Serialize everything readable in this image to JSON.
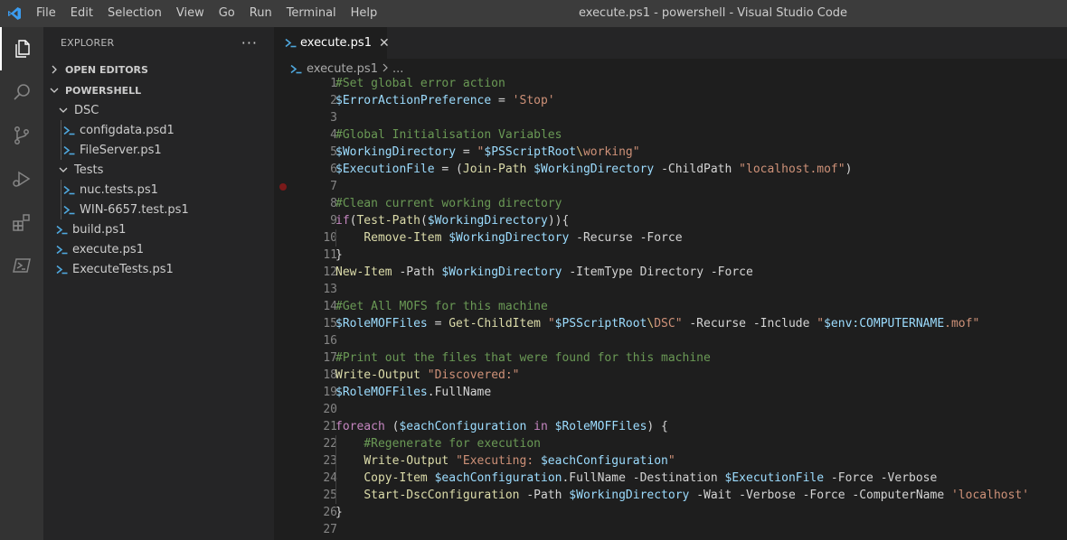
{
  "titlebar": {
    "menu": [
      "File",
      "Edit",
      "Selection",
      "View",
      "Go",
      "Run",
      "Terminal",
      "Help"
    ],
    "window_title": "execute.ps1 - powershell - Visual Studio Code"
  },
  "activitybar": {
    "items": [
      "explorer-icon",
      "search-icon",
      "source-control-icon",
      "run-debug-icon",
      "extensions-icon",
      "powershell-icon"
    ]
  },
  "sidebar": {
    "header": "EXPLORER",
    "more": "···",
    "open_editors": "OPEN EDITORS",
    "workspace": "POWERSHELL",
    "tree": [
      {
        "label": "DSC",
        "type": "folder",
        "depth": 1
      },
      {
        "label": "configdata.psd1",
        "type": "file",
        "depth": 2
      },
      {
        "label": "FileServer.ps1",
        "type": "file",
        "depth": 2
      },
      {
        "label": "Tests",
        "type": "folder",
        "depth": 1
      },
      {
        "label": "nuc.tests.ps1",
        "type": "file",
        "depth": 2
      },
      {
        "label": "WIN-6657.test.ps1",
        "type": "file",
        "depth": 2
      },
      {
        "label": "build.ps1",
        "type": "file",
        "depth": 1
      },
      {
        "label": "execute.ps1",
        "type": "file",
        "depth": 1
      },
      {
        "label": "ExecuteTests.ps1",
        "type": "file",
        "depth": 1
      }
    ]
  },
  "editor": {
    "tab_label": "execute.ps1",
    "tab_close": "✕",
    "breadcrumb_file": "execute.ps1",
    "breadcrumb_more": "...",
    "breakpoint_line": 7,
    "lines": [
      {
        "n": "1",
        "text": "#Set global error action"
      },
      {
        "n": "2",
        "text": "$ErrorActionPreference = 'Stop'"
      },
      {
        "n": "3",
        "text": ""
      },
      {
        "n": "4",
        "text": "#Global Initialisation Variables"
      },
      {
        "n": "5",
        "text": "$WorkingDirectory = \"$PSScriptRoot\\working\""
      },
      {
        "n": "6",
        "text": "$ExecutionFile = (Join-Path $WorkingDirectory -ChildPath \"localhost.mof\")"
      },
      {
        "n": "7",
        "text": ""
      },
      {
        "n": "8",
        "text": "#Clean current working directory"
      },
      {
        "n": "9",
        "text": "if(Test-Path($WorkingDirectory)){"
      },
      {
        "n": "10",
        "text": "    Remove-Item $WorkingDirectory -Recurse -Force"
      },
      {
        "n": "11",
        "text": "}"
      },
      {
        "n": "12",
        "text": "New-Item -Path $WorkingDirectory -ItemType Directory -Force"
      },
      {
        "n": "13",
        "text": ""
      },
      {
        "n": "14",
        "text": "#Get All MOFS for this machine"
      },
      {
        "n": "15",
        "text": "$RoleMOFFiles = Get-ChildItem \"$PSScriptRoot\\DSC\" -Recurse -Include \"$env:COMPUTERNAME.mof\""
      },
      {
        "n": "16",
        "text": ""
      },
      {
        "n": "17",
        "text": "#Print out the files that were found for this machine"
      },
      {
        "n": "18",
        "text": "Write-Output \"Discovered:\""
      },
      {
        "n": "19",
        "text": "$RoleMOFFiles.FullName"
      },
      {
        "n": "20",
        "text": ""
      },
      {
        "n": "21",
        "text": "foreach ($eachConfiguration in $RoleMOFFiles) {"
      },
      {
        "n": "22",
        "text": "    #Regenerate for execution"
      },
      {
        "n": "23",
        "text": "    Write-Output \"Executing: $eachConfiguration\""
      },
      {
        "n": "24",
        "text": "    Copy-Item $eachConfiguration.FullName -Destination $ExecutionFile -Force -Verbose"
      },
      {
        "n": "25",
        "text": "    Start-DscConfiguration -Path $WorkingDirectory -Wait -Verbose -Force -ComputerName 'localhost'"
      },
      {
        "n": "26",
        "text": "}"
      },
      {
        "n": "27",
        "text": ""
      }
    ]
  }
}
